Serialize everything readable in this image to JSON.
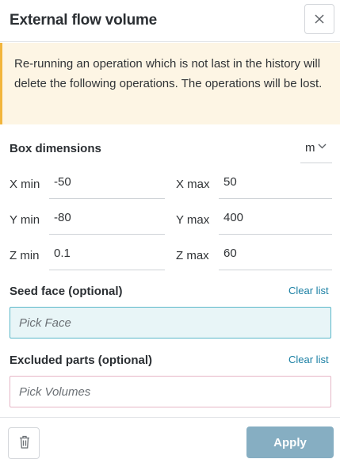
{
  "dialog": {
    "title": "External flow volume"
  },
  "warning": {
    "text": "Re-running an operation which is not last in the history will delete the following operations. The operations will be lost."
  },
  "box_dimensions": {
    "title": "Box dimensions",
    "unit": "m",
    "fields": {
      "x_min": {
        "label": "X min",
        "value": "-50"
      },
      "x_max": {
        "label": "X max",
        "value": "50"
      },
      "y_min": {
        "label": "Y min",
        "value": "-80"
      },
      "y_max": {
        "label": "Y max",
        "value": "400"
      },
      "z_min": {
        "label": "Z min",
        "value": "0.1"
      },
      "z_max": {
        "label": "Z max",
        "value": "60"
      }
    }
  },
  "seed_face": {
    "title": "Seed face (optional)",
    "clear_label": "Clear list",
    "placeholder": "Pick Face"
  },
  "excluded_parts": {
    "title": "Excluded parts (optional)",
    "clear_label": "Clear list",
    "placeholder": "Pick Volumes"
  },
  "footer": {
    "apply_label": "Apply"
  },
  "icons": {
    "close": "close-icon",
    "chevron": "chevron-down-icon",
    "trash": "trash-icon"
  },
  "colors": {
    "warning_bg": "#fdf5e4",
    "warning_border": "#f2b53c",
    "link": "#1a7fa3",
    "apply_bg": "#86aec2",
    "seed_highlight": "#e8f5f7"
  }
}
